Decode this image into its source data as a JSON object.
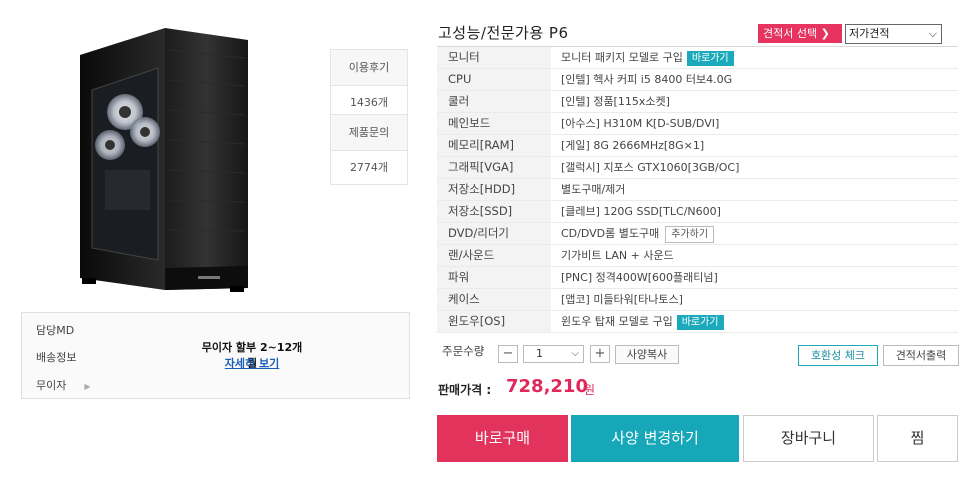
{
  "product": {
    "title": "고성능/전문가용 P6",
    "image_icon": "pc-case-image"
  },
  "stats": {
    "reviews_label": "이용후기",
    "reviews_count": "1436개",
    "qna_label": "제품문의",
    "qna_count": "2774개"
  },
  "info": {
    "md_label": "담당MD",
    "shipping_label": "배송정보",
    "interest_free_label": "무이자",
    "installment_text": "무이자 할부 2~12개월",
    "installment_link": "자세히 보기"
  },
  "quote": {
    "select_button": "견적서 선택 ❯",
    "selected_option": "저가견적"
  },
  "specs": [
    {
      "key": "모니터",
      "value": "모니터 패키지 모델로 구입",
      "button": "바로가기",
      "button_style": "teal"
    },
    {
      "key": "CPU",
      "value": "[인텔] 헥사 커피 i5 8400 터보4.0G"
    },
    {
      "key": "쿨러",
      "value": "[인텔] 정품[115x소켓]"
    },
    {
      "key": "메인보드",
      "value": "[아수스] H310M K[D-SUB/DVI]"
    },
    {
      "key": "메모리[RAM]",
      "value": "[게일] 8G 2666MHz[8G×1]"
    },
    {
      "key": "그래픽[VGA]",
      "value": "[갤럭시] 지포스 GTX1060[3GB/OC]"
    },
    {
      "key": "저장소[HDD]",
      "value": "별도구매/제거"
    },
    {
      "key": "저장소[SSD]",
      "value": "[클레브] 120G SSD[TLC/N600]"
    },
    {
      "key": "DVD/리더기",
      "value": "CD/DVD롬 별도구매",
      "button": "추가하기",
      "button_style": "gray"
    },
    {
      "key": "랜/사운드",
      "value": "기가비트 LAN + 사운드"
    },
    {
      "key": "파워",
      "value": "[PNC] 정격400W[600플래티넘]"
    },
    {
      "key": "케이스",
      "value": "[앱코] 미들타워[타나토스]"
    },
    {
      "key": "윈도우[OS]",
      "value": "윈도우 탑재 모델로 구입",
      "button": "바로가기",
      "button_style": "teal"
    }
  ],
  "order": {
    "qty_label": "주문수량",
    "qty_value": "1",
    "minus": "−",
    "plus": "+",
    "copy_spec": "사양복사",
    "compat_check": "호환성 체크",
    "print_quote": "견적서출력"
  },
  "price": {
    "label": "판매가격 :",
    "value": "728,210",
    "unit": "원"
  },
  "actions": {
    "buy_now": "바로구매",
    "change_spec": "사양 변경하기",
    "cart": "장바구니",
    "wish": "찜"
  },
  "colors": {
    "accent_pink": "#e2335c",
    "accent_teal": "#16a7b8"
  }
}
